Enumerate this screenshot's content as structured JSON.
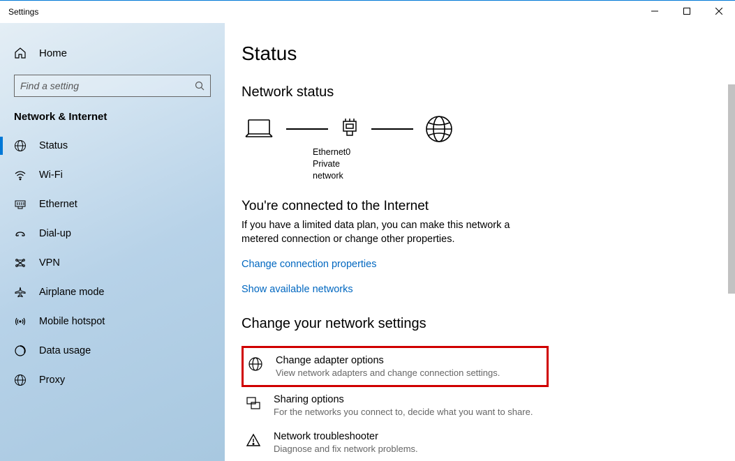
{
  "window": {
    "title": "Settings"
  },
  "sidebar": {
    "home_label": "Home",
    "search_placeholder": "Find a setting",
    "section_title": "Network & Internet",
    "items": [
      {
        "label": "Status",
        "selected": true
      },
      {
        "label": "Wi-Fi"
      },
      {
        "label": "Ethernet"
      },
      {
        "label": "Dial-up"
      },
      {
        "label": "VPN"
      },
      {
        "label": "Airplane mode"
      },
      {
        "label": "Mobile hotspot"
      },
      {
        "label": "Data usage"
      },
      {
        "label": "Proxy"
      }
    ]
  },
  "main": {
    "page_title": "Status",
    "network_status_heading": "Network status",
    "diagram": {
      "adapter_name": "Ethernet0",
      "network_type": "Private network"
    },
    "connected_heading": "You're connected to the Internet",
    "connected_desc": "If you have a limited data plan, you can make this network a metered connection or change other properties.",
    "link_change_properties": "Change connection properties",
    "link_show_networks": "Show available networks",
    "change_settings_heading": "Change your network settings",
    "rows": [
      {
        "title": "Change adapter options",
        "desc": "View network adapters and change connection settings.",
        "highlight": true
      },
      {
        "title": "Sharing options",
        "desc": "For the networks you connect to, decide what you want to share."
      },
      {
        "title": "Network troubleshooter",
        "desc": "Diagnose and fix network problems."
      }
    ]
  }
}
